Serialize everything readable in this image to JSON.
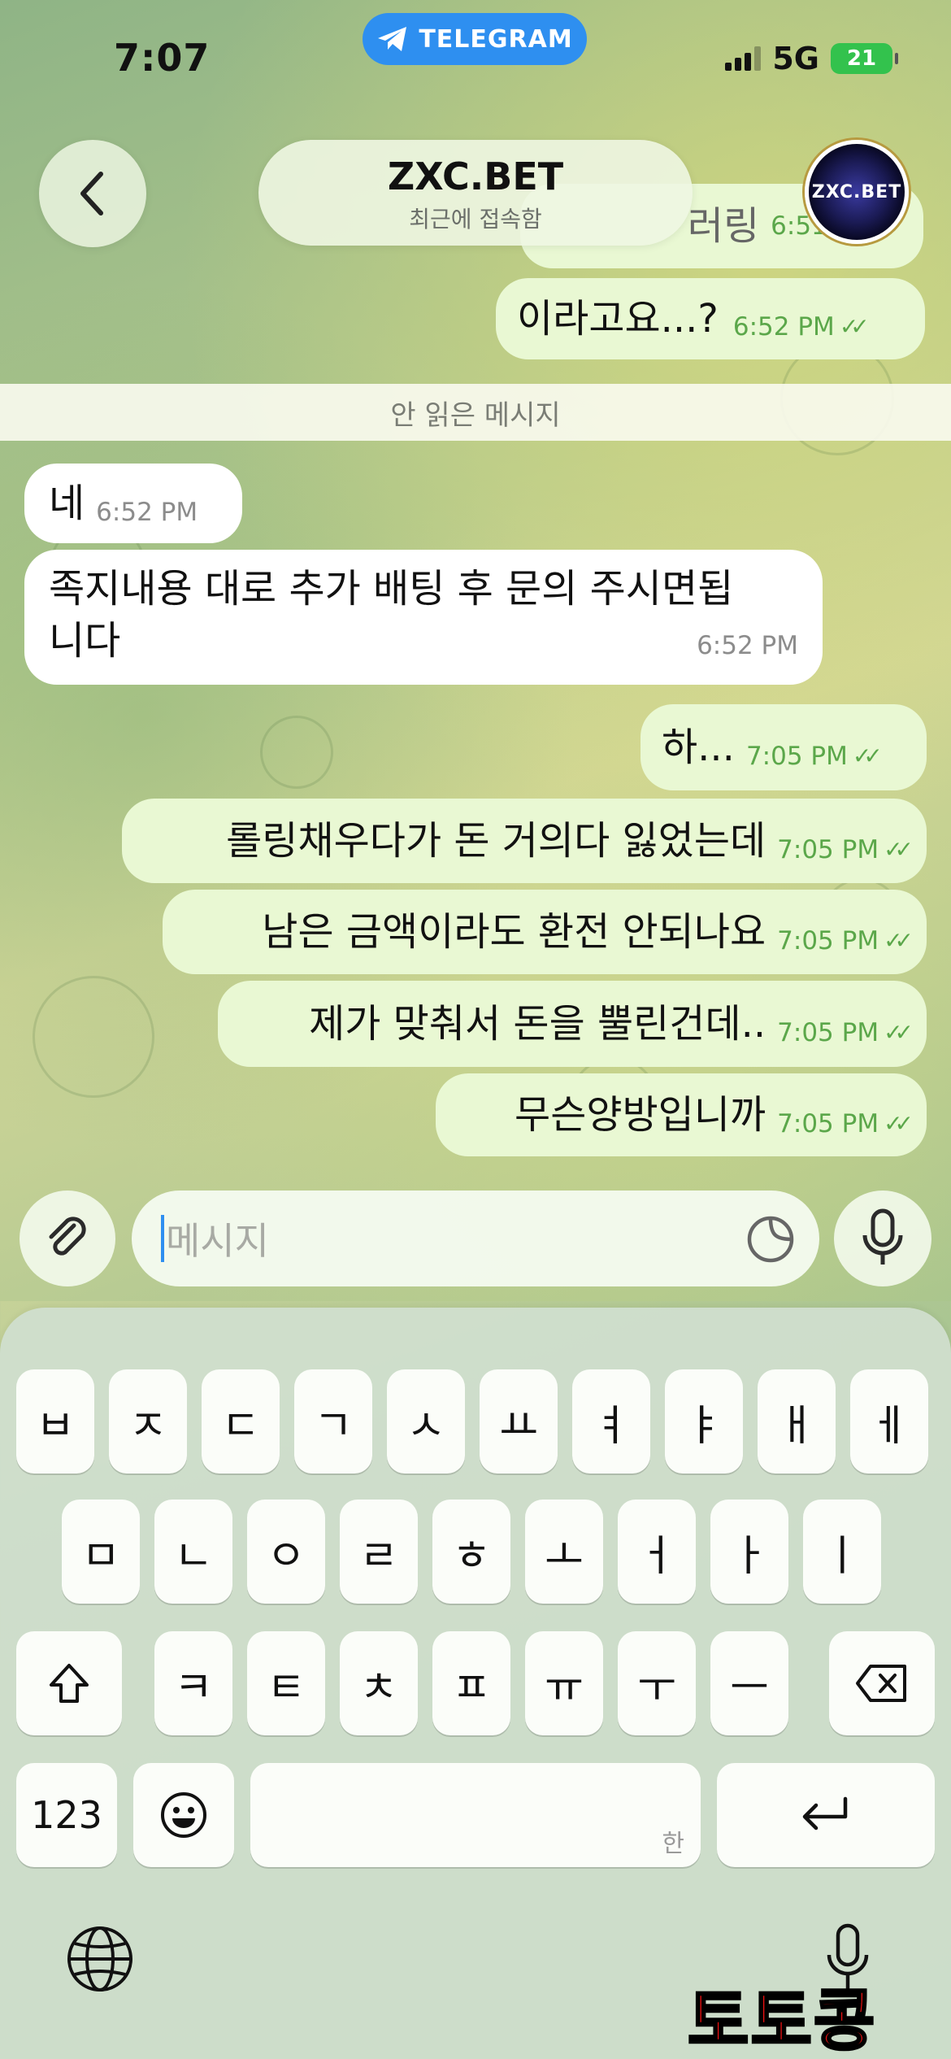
{
  "status_bar": {
    "time": "7:07",
    "pill_label": "TELEGRAM",
    "network": "5G",
    "battery": "21"
  },
  "header": {
    "name": "ZXC.BET",
    "status": "최근에 접속함",
    "avatar_text": "ZXC.BET"
  },
  "unread_divider": "안 읽은 메시지",
  "messages": [
    {
      "dir": "out",
      "text": "이라고요...?",
      "time": "6:52 PM"
    },
    {
      "dir": "in",
      "text": "네",
      "time": "6:52 PM"
    },
    {
      "dir": "in",
      "text": "족지내용 대로 추가 배팅 후 문의 주시면됩",
      "text2": "니다",
      "time": "6:52 PM"
    },
    {
      "dir": "out",
      "text": "하...",
      "time": "7:05 PM"
    },
    {
      "dir": "out",
      "text": "롤링채우다가 돈 거의다 잃었는데",
      "time": "7:05 PM"
    },
    {
      "dir": "out",
      "text": "남은 금액이라도 환전 안되나요",
      "time": "7:05 PM"
    },
    {
      "dir": "out",
      "text": "제가 맞춰서 돈을 뿔린건데..",
      "time": "7:05 PM"
    },
    {
      "dir": "out",
      "text": "무슨양방입니까",
      "time": "7:05 PM"
    }
  ],
  "partial_top": {
    "text": "러링",
    "time": "6:51 PM"
  },
  "input": {
    "placeholder": "메시지"
  },
  "keyboard": {
    "row1": [
      "ㅂ",
      "ㅈ",
      "ㄷ",
      "ㄱ",
      "ㅅ",
      "ㅛ",
      "ㅕ",
      "ㅑ",
      "ㅐ",
      "ㅔ"
    ],
    "row2": [
      "ㅁ",
      "ㄴ",
      "ㅇ",
      "ㄹ",
      "ㅎ",
      "ㅗ",
      "ㅓ",
      "ㅏ",
      "ㅣ"
    ],
    "row3": [
      "ㅋ",
      "ㅌ",
      "ㅊ",
      "ㅍ",
      "ㅠ",
      "ㅜ",
      "ㅡ"
    ],
    "numbers_key": "123",
    "space_hint": "한"
  },
  "watermark": "토토콩",
  "colors": {
    "accent": "#2e8ff0",
    "outgoing_bubble": "#e9f8d3",
    "incoming_bubble": "#ffffff",
    "read_check": "#5ba74a"
  }
}
